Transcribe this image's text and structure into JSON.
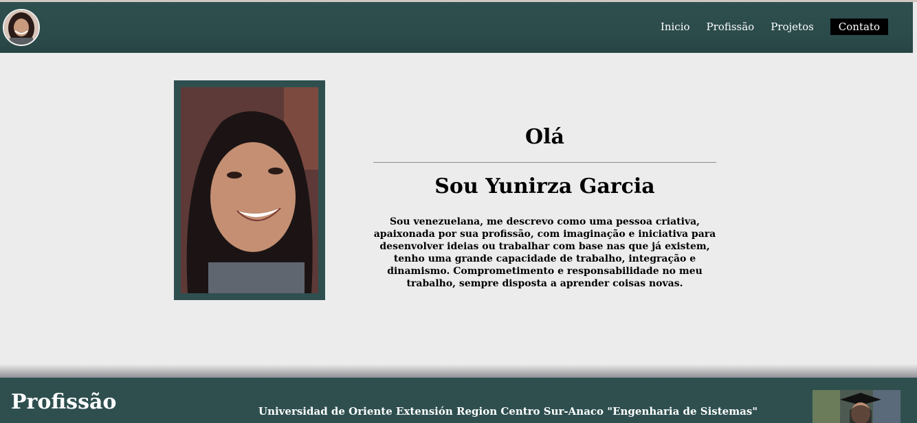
{
  "nav": {
    "items": [
      {
        "label": "Inicio"
      },
      {
        "label": "Profissão"
      },
      {
        "label": "Projetos"
      },
      {
        "label": "Contato"
      }
    ]
  },
  "hero": {
    "greeting": "Olá",
    "name": "Sou Yunirza Garcia",
    "bio": "Sou venezuelana, me descrevo como uma pessoa criativa, apaixonada por sua profissão, com imaginação e iniciativa para desenvolver ideias ou trabalhar com base nas que já existem, tenho uma grande capacidade de trabalho, integração e dinamismo. Comprometimento e responsabilidade no meu trabalho, sempre disposta a aprender coisas novas."
  },
  "profession": {
    "title": "Profissão",
    "university": "Universidad de Oriente Extensión Region Centro Sur-Anaco \"Engenharia de Sistemas\""
  },
  "colors": {
    "primary": "#2f4f4f",
    "background": "#ececec",
    "contact_button": "#000000"
  }
}
